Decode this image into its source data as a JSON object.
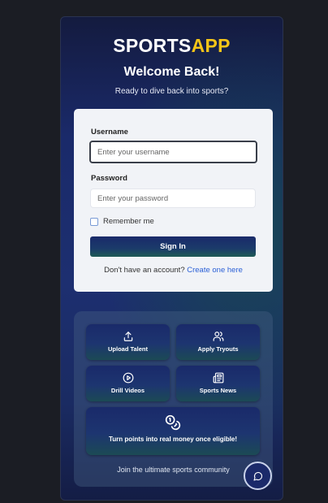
{
  "brand": {
    "part1": "SPORTS",
    "part2": "APP"
  },
  "header": {
    "title": "Welcome Back!",
    "subtitle": "Ready to dive back into sports?"
  },
  "form": {
    "username_label": "Username",
    "username_placeholder": "Enter your username",
    "password_label": "Password",
    "password_placeholder": "Enter your password",
    "remember_label": "Remember me",
    "signin_label": "Sign In",
    "signup_text": "Don't have an account?",
    "signup_link": "Create one here"
  },
  "features": {
    "tiles": [
      {
        "label": "Upload Talent",
        "icon": "upload-icon"
      },
      {
        "label": "Apply Tryouts",
        "icon": "users-icon"
      },
      {
        "label": "Drill Videos",
        "icon": "play-circle-icon"
      },
      {
        "label": "Sports News",
        "icon": "newspaper-icon"
      }
    ],
    "rewards_text": "Turn points into real money once eligible!",
    "rewards_icon": "coins-icon",
    "community_text": "Join the ultimate sports community"
  },
  "chat": {
    "icon": "chat-icon"
  },
  "colors": {
    "brand_accent": "#f5c518",
    "link": "#2a5fd6",
    "primary_dark": "#1a2a6a"
  }
}
